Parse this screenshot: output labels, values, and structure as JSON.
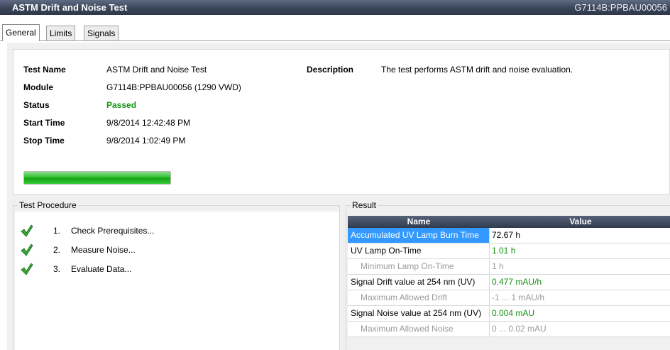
{
  "window": {
    "title": "ASTM Drift and Noise Test",
    "instrument": "G7114B:PPBAU00056"
  },
  "tabs": [
    {
      "label": "General",
      "active": true
    },
    {
      "label": "Limits",
      "active": false
    },
    {
      "label": "Signals",
      "active": false
    }
  ],
  "info": {
    "test_name_label": "Test Name",
    "test_name": "ASTM Drift and Noise Test",
    "module_label": "Module",
    "module": "G7114B:PPBAU00056 (1290 VWD)",
    "status_label": "Status",
    "status": "Passed",
    "start_label": "Start Time",
    "start": "9/8/2014 12:42:48 PM",
    "stop_label": "Stop Time",
    "stop": "9/8/2014 1:02:49 PM",
    "description_label": "Description",
    "description": "The test performs ASTM drift and noise evaluation.",
    "progress": 1.0,
    "status_color": "#139113",
    "progress_color": "#2fc02f"
  },
  "procedure": {
    "title": "Test Procedure",
    "steps": [
      {
        "num": "1.",
        "label": "Check Prerequisites...",
        "icon": "checkmark-icon"
      },
      {
        "num": "2.",
        "label": "Measure Noise...",
        "icon": "checkmark-icon"
      },
      {
        "num": "3.",
        "label": "Evaluate Data...",
        "icon": "checkmark-icon"
      }
    ]
  },
  "result": {
    "title": "Result",
    "headers": {
      "name": "Name",
      "value": "Value"
    },
    "rows": [
      {
        "name": "Accumulated UV Lamp Burn Time",
        "value": "72.67 h",
        "style": "normal",
        "sub": false,
        "selected": true
      },
      {
        "name": "UV Lamp On-Time",
        "value": "1.01 h",
        "style": "green",
        "sub": false,
        "selected": false
      },
      {
        "name": "Minimum Lamp On-Time",
        "value": "1 h",
        "style": "grey",
        "sub": true,
        "selected": false
      },
      {
        "name": "Signal Drift value at 254 nm (UV)",
        "value": "0.477 mAU/h",
        "style": "green",
        "sub": false,
        "selected": false
      },
      {
        "name": "Maximum Allowed Drift",
        "value": "-1 ... 1 mAU/h",
        "style": "grey",
        "sub": true,
        "selected": false
      },
      {
        "name": "Signal Noise value at 254 nm (UV)",
        "value": "0.004 mAU",
        "style": "green",
        "sub": false,
        "selected": false
      },
      {
        "name": "Maximum Allowed Noise",
        "value": "0 ... 0.02 mAU",
        "style": "grey",
        "sub": true,
        "selected": false
      }
    ]
  }
}
